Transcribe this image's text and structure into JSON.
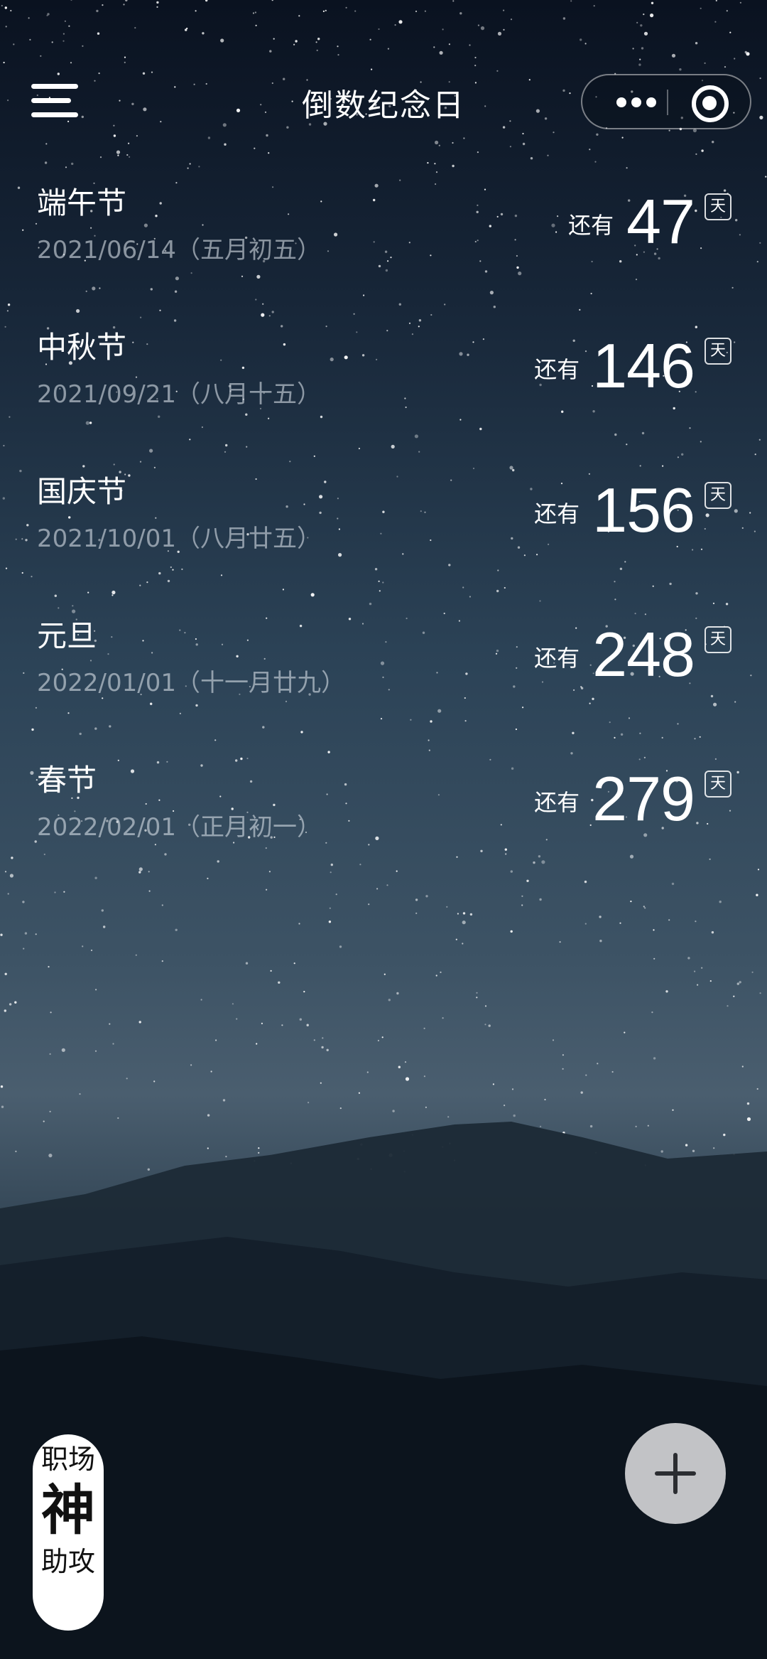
{
  "header": {
    "title": "倒数纪念日",
    "menu_icon": "hamburger-icon",
    "more_icon": "more-dots-icon",
    "close_icon": "mini-program-close-icon"
  },
  "events": [
    {
      "name": "端午节",
      "date": "2021/06/14（五月初五）",
      "prefix": "还有",
      "days": "47",
      "unit": "天"
    },
    {
      "name": "中秋节",
      "date": "2021/09/21（八月十五）",
      "prefix": "还有",
      "days": "146",
      "unit": "天"
    },
    {
      "name": "国庆节",
      "date": "2021/10/01（八月廿五）",
      "prefix": "还有",
      "days": "156",
      "unit": "天"
    },
    {
      "name": "元旦",
      "date": "2022/01/01（十一月廿九）",
      "prefix": "还有",
      "days": "248",
      "unit": "天"
    },
    {
      "name": "春节",
      "date": "2022/02/01（正月初一）",
      "prefix": "还有",
      "days": "279",
      "unit": "天"
    }
  ],
  "badge": {
    "line1": "职场",
    "line2": "神",
    "line3": "助攻"
  },
  "add_button": {
    "icon": "plus-icon"
  },
  "colors": {
    "add_button_bg": "#c2c3c6",
    "text": "#ffffff",
    "date_text": "#d2dae2"
  }
}
